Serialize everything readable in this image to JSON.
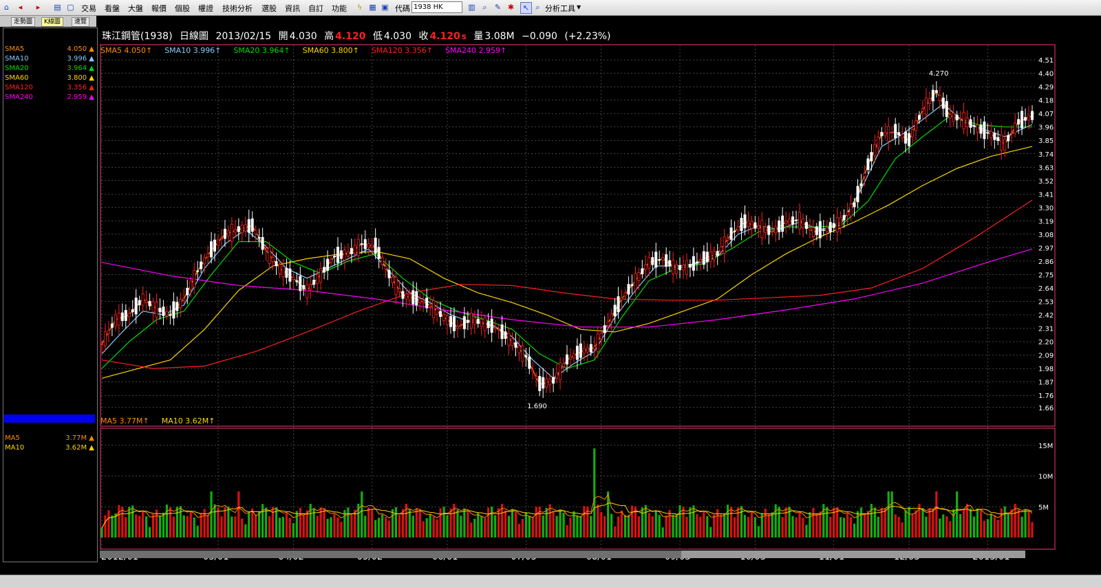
{
  "menu": {
    "items": [
      "交易",
      "看盤",
      "大盤",
      "報價",
      "個股",
      "權證",
      "技術分析",
      "選股",
      "資訊",
      "自訂",
      "功能"
    ],
    "code_label": "代碼",
    "code_value": "1938 HK",
    "analysis_tools": "分析工具"
  },
  "tabs": [
    "走勢圖",
    "K線圖",
    "速覽"
  ],
  "header": {
    "title": "珠江鋼管(1938)",
    "period": "日線圖",
    "date": "2013/02/15",
    "open_label": "開",
    "open": "4.030",
    "high_label": "高",
    "high": "4.120",
    "low_label": "低",
    "low": "4.030",
    "close_label": "收",
    "close": "4.120",
    "close_suffix": "s",
    "vol_label": "量",
    "volume": "3.08M",
    "change": "−0.090",
    "change_pct": "(+2.23%)"
  },
  "left_panel": {
    "ma_rows": [
      {
        "name": "SMA5",
        "value": "4.050",
        "color": "#ff8c00"
      },
      {
        "name": "SMA10",
        "value": "3.996",
        "color": "#87cefa"
      },
      {
        "name": "SMA20",
        "value": "3.964",
        "color": "#00dd00"
      },
      {
        "name": "SMA60",
        "value": "3.800",
        "color": "#ffd700"
      },
      {
        "name": "SMA120",
        "value": "3.356",
        "color": "#ff2020"
      },
      {
        "name": "SMA240",
        "value": "2.959",
        "color": "#ff00ff"
      }
    ],
    "vol_rows": [
      {
        "name": "MA5",
        "value": "3.77M",
        "color": "#ff8c00"
      },
      {
        "name": "MA10",
        "value": "3.62M",
        "color": "#ffd700"
      }
    ]
  },
  "legend": [
    {
      "text": "SMA5 4.050",
      "color": "#ff8c00"
    },
    {
      "text": "SMA10 3.996",
      "color": "#87cefa"
    },
    {
      "text": "SMA20 3.964",
      "color": "#00dd00"
    },
    {
      "text": "SMA60 3.800",
      "color": "#ffd700"
    },
    {
      "text": "SMA120 3.356",
      "color": "#ff2020"
    },
    {
      "text": "SMA240 2.959",
      "color": "#ff00ff"
    }
  ],
  "volume_legend": [
    {
      "text": "MA5 3.77M",
      "color": "#ff8c00"
    },
    {
      "text": "MA10 3.62M",
      "color": "#ffd700"
    }
  ],
  "chart_data": {
    "type": "line",
    "title": "珠江鋼管(1938) 日線圖",
    "x_ticks": [
      "2012/01",
      "03/01",
      "04/02",
      "05/02",
      "06/01",
      "07/03",
      "08/01",
      "09/03",
      "10/03",
      "11/01",
      "12/03",
      "2013/01"
    ],
    "price_ticks": [
      1.66,
      1.76,
      1.87,
      1.98,
      2.09,
      2.2,
      2.31,
      2.42,
      2.53,
      2.64,
      2.75,
      2.86,
      2.97,
      3.08,
      3.19,
      3.3,
      3.41,
      3.52,
      3.63,
      3.74,
      3.85,
      3.96,
      4.07,
      4.18,
      4.29,
      4.4,
      4.51
    ],
    "volume_ticks": [
      "15M",
      "10M",
      "5M"
    ],
    "ylim": [
      1.62,
      4.55
    ],
    "volume_ylim": [
      0,
      17
    ],
    "high_marker": "4.270",
    "low_marker": "1.690",
    "series": [
      {
        "name": "SMA5",
        "color": "#ff8c00",
        "points": [
          [
            0,
            2.18
          ],
          [
            4,
            2.38
          ],
          [
            8,
            2.42
          ],
          [
            12,
            2.55
          ],
          [
            16,
            2.47
          ],
          [
            20,
            2.42
          ],
          [
            24,
            2.55
          ],
          [
            28,
            2.78
          ],
          [
            32,
            2.95
          ],
          [
            36,
            3.08
          ],
          [
            40,
            3.12
          ],
          [
            44,
            3.15
          ],
          [
            48,
            2.95
          ],
          [
            52,
            2.8
          ],
          [
            56,
            2.72
          ],
          [
            60,
            2.62
          ],
          [
            64,
            2.75
          ],
          [
            68,
            2.9
          ],
          [
            72,
            2.92
          ],
          [
            76,
            3.0
          ],
          [
            80,
            2.98
          ],
          [
            84,
            2.75
          ],
          [
            88,
            2.58
          ],
          [
            92,
            2.55
          ],
          [
            96,
            2.5
          ],
          [
            100,
            2.4
          ],
          [
            104,
            2.32
          ],
          [
            108,
            2.38
          ],
          [
            112,
            2.35
          ],
          [
            116,
            2.3
          ],
          [
            120,
            2.2
          ],
          [
            124,
            2.08
          ],
          [
            128,
            1.85
          ],
          [
            132,
            1.88
          ],
          [
            136,
            2.05
          ],
          [
            140,
            2.12
          ],
          [
            144,
            2.15
          ],
          [
            148,
            2.35
          ],
          [
            152,
            2.55
          ],
          [
            156,
            2.7
          ],
          [
            160,
            2.85
          ],
          [
            164,
            2.88
          ],
          [
            168,
            2.8
          ],
          [
            172,
            2.82
          ],
          [
            176,
            2.88
          ],
          [
            180,
            2.92
          ],
          [
            184,
            3.08
          ],
          [
            188,
            3.18
          ],
          [
            192,
            3.14
          ],
          [
            196,
            3.1
          ],
          [
            200,
            3.18
          ],
          [
            204,
            3.2
          ],
          [
            208,
            3.1
          ],
          [
            212,
            3.12
          ],
          [
            216,
            3.18
          ],
          [
            220,
            3.32
          ],
          [
            224,
            3.65
          ],
          [
            228,
            3.9
          ],
          [
            232,
            3.92
          ],
          [
            236,
            3.85
          ],
          [
            240,
            4.1
          ],
          [
            244,
            4.25
          ],
          [
            248,
            4.05
          ],
          [
            252,
            4.02
          ],
          [
            256,
            3.95
          ],
          [
            260,
            3.9
          ],
          [
            264,
            3.82
          ],
          [
            268,
            4.0
          ],
          [
            272,
            4.05
          ]
        ]
      },
      {
        "name": "SMA10",
        "color": "#87cefa",
        "points": [
          [
            0,
            2.1
          ],
          [
            6,
            2.28
          ],
          [
            12,
            2.45
          ],
          [
            18,
            2.42
          ],
          [
            24,
            2.5
          ],
          [
            30,
            2.8
          ],
          [
            36,
            3.0
          ],
          [
            42,
            3.12
          ],
          [
            48,
            2.98
          ],
          [
            54,
            2.8
          ],
          [
            60,
            2.72
          ],
          [
            66,
            2.8
          ],
          [
            72,
            2.88
          ],
          [
            78,
            2.96
          ],
          [
            84,
            2.78
          ],
          [
            90,
            2.6
          ],
          [
            96,
            2.52
          ],
          [
            102,
            2.42
          ],
          [
            108,
            2.36
          ],
          [
            114,
            2.34
          ],
          [
            120,
            2.24
          ],
          [
            126,
            2.05
          ],
          [
            132,
            1.9
          ],
          [
            138,
            2.02
          ],
          [
            144,
            2.12
          ],
          [
            150,
            2.4
          ],
          [
            156,
            2.62
          ],
          [
            162,
            2.82
          ],
          [
            168,
            2.82
          ],
          [
            174,
            2.84
          ],
          [
            180,
            2.9
          ],
          [
            186,
            3.08
          ],
          [
            192,
            3.15
          ],
          [
            198,
            3.12
          ],
          [
            204,
            3.18
          ],
          [
            210,
            3.12
          ],
          [
            216,
            3.16
          ],
          [
            222,
            3.45
          ],
          [
            228,
            3.8
          ],
          [
            234,
            3.9
          ],
          [
            240,
            4.02
          ],
          [
            246,
            4.15
          ],
          [
            252,
            4.0
          ],
          [
            258,
            3.94
          ],
          [
            264,
            3.88
          ],
          [
            272,
            3.98
          ]
        ]
      },
      {
        "name": "SMA20",
        "color": "#00dd00",
        "points": [
          [
            0,
            1.98
          ],
          [
            8,
            2.2
          ],
          [
            16,
            2.38
          ],
          [
            24,
            2.45
          ],
          [
            32,
            2.75
          ],
          [
            40,
            3.02
          ],
          [
            48,
            3.02
          ],
          [
            56,
            2.85
          ],
          [
            64,
            2.76
          ],
          [
            72,
            2.86
          ],
          [
            80,
            2.92
          ],
          [
            88,
            2.72
          ],
          [
            96,
            2.55
          ],
          [
            104,
            2.45
          ],
          [
            112,
            2.38
          ],
          [
            120,
            2.3
          ],
          [
            128,
            2.1
          ],
          [
            136,
            1.98
          ],
          [
            144,
            2.05
          ],
          [
            152,
            2.4
          ],
          [
            160,
            2.7
          ],
          [
            168,
            2.8
          ],
          [
            176,
            2.84
          ],
          [
            184,
            2.96
          ],
          [
            192,
            3.1
          ],
          [
            200,
            3.14
          ],
          [
            208,
            3.14
          ],
          [
            216,
            3.15
          ],
          [
            224,
            3.35
          ],
          [
            232,
            3.7
          ],
          [
            240,
            3.88
          ],
          [
            248,
            4.05
          ],
          [
            256,
            3.98
          ],
          [
            264,
            3.96
          ],
          [
            272,
            3.96
          ]
        ]
      },
      {
        "name": "SMA60",
        "color": "#ffd700",
        "points": [
          [
            0,
            1.9
          ],
          [
            20,
            2.05
          ],
          [
            30,
            2.3
          ],
          [
            40,
            2.62
          ],
          [
            50,
            2.82
          ],
          [
            60,
            2.88
          ],
          [
            70,
            2.92
          ],
          [
            80,
            2.94
          ],
          [
            90,
            2.88
          ],
          [
            100,
            2.72
          ],
          [
            110,
            2.6
          ],
          [
            120,
            2.52
          ],
          [
            130,
            2.42
          ],
          [
            140,
            2.3
          ],
          [
            150,
            2.28
          ],
          [
            160,
            2.35
          ],
          [
            170,
            2.45
          ],
          [
            180,
            2.55
          ],
          [
            190,
            2.75
          ],
          [
            200,
            2.92
          ],
          [
            210,
            3.06
          ],
          [
            220,
            3.18
          ],
          [
            230,
            3.32
          ],
          [
            240,
            3.48
          ],
          [
            250,
            3.62
          ],
          [
            260,
            3.72
          ],
          [
            272,
            3.8
          ]
        ]
      },
      {
        "name": "SMA120",
        "color": "#ff2020",
        "points": [
          [
            0,
            2.05
          ],
          [
            15,
            1.98
          ],
          [
            30,
            2.0
          ],
          [
            45,
            2.12
          ],
          [
            60,
            2.28
          ],
          [
            75,
            2.45
          ],
          [
            90,
            2.6
          ],
          [
            105,
            2.67
          ],
          [
            120,
            2.66
          ],
          [
            135,
            2.6
          ],
          [
            150,
            2.55
          ],
          [
            165,
            2.54
          ],
          [
            180,
            2.54
          ],
          [
            195,
            2.56
          ],
          [
            210,
            2.58
          ],
          [
            225,
            2.64
          ],
          [
            240,
            2.8
          ],
          [
            255,
            3.05
          ],
          [
            272,
            3.36
          ]
        ]
      },
      {
        "name": "SMA240",
        "color": "#ff00ff",
        "points": [
          [
            0,
            2.85
          ],
          [
            20,
            2.74
          ],
          [
            40,
            2.66
          ],
          [
            60,
            2.62
          ],
          [
            80,
            2.55
          ],
          [
            100,
            2.46
          ],
          [
            120,
            2.38
          ],
          [
            140,
            2.32
          ],
          [
            160,
            2.32
          ],
          [
            180,
            2.38
          ],
          [
            200,
            2.46
          ],
          [
            220,
            2.55
          ],
          [
            240,
            2.68
          ],
          [
            260,
            2.86
          ],
          [
            272,
            2.96
          ]
        ]
      }
    ]
  }
}
